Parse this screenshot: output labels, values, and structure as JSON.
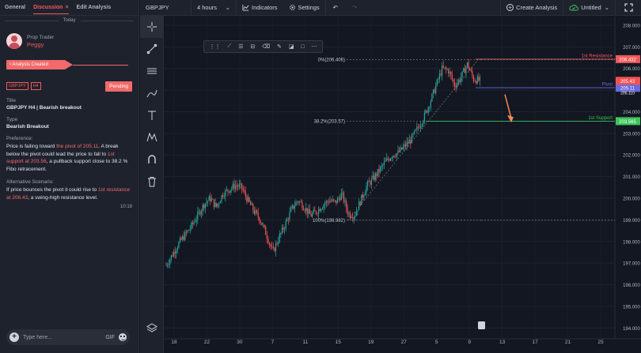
{
  "tabs": [
    {
      "label": "General"
    },
    {
      "label": "Discussion",
      "close": "×"
    },
    {
      "label": "Edit Analysis"
    }
  ],
  "day_separator": "Today",
  "trader": {
    "role": "Prop Trader",
    "name": "Peggy"
  },
  "status_banner": "♀Analysis Created",
  "tags": [
    "GBPJPY",
    "H4"
  ],
  "status_badge": "Pending",
  "labels": {
    "title": "Title",
    "type": "Type",
    "preference": "Preference:",
    "alternative": "Alternative Scenario:"
  },
  "analysis": {
    "title": "GBPJPY H4 | Bearish breakout",
    "type": "Bearish Breakout",
    "preference": {
      "t1": "Price is failing toward ",
      "h1": "the pivot of 205.11",
      "t2": ". A break below the pivot could lead the price to fall to ",
      "h2": "1st support at 203.56",
      "t3": ", a pullback support close to 38.2 % Fibo retracement."
    },
    "alternative": {
      "t1": "If price bounces the pivot it could rise to ",
      "h1": "1st resistance at 206.43",
      "t2": ", a swing-high resistance level."
    },
    "time": "10:18"
  },
  "comment": {
    "placeholder": "Type here...",
    "gif": "GIF"
  },
  "topbar": {
    "symbol": "GBPJPY",
    "interval": "4 hours",
    "indicators": "Indicators",
    "settings": "Settings",
    "create": "Create Analysis",
    "untitled": "Untitled"
  },
  "toolbar_icons": [
    "crosshair-icon",
    "trend-line-icon",
    "parallel-channel-icon",
    "brush-icon",
    "text-icon",
    "pattern-icon",
    "magnet-icon",
    "trash-icon",
    "layers-icon"
  ],
  "drawbar_icons": [
    "drag-handle-icon",
    "ray-icon",
    "horizontal-lines-icon",
    "channel-icon",
    "eraser-icon",
    "pen-icon",
    "fill-icon",
    "rectangle-icon",
    "more-icon"
  ],
  "colors": {
    "bull": "#26a69a",
    "bear": "#ef5350",
    "resistance": "#f05a5a",
    "pivot": "#6a6ae0",
    "support": "#3ec45a",
    "arrow": "#f7865a"
  },
  "chart_data": {
    "type": "candlestick",
    "symbol": "GBPJPY",
    "interval": "4 hours",
    "y_ticks": [
      "208.000",
      "207.000",
      "206.000",
      "205.000",
      "204.000",
      "203.000",
      "202.000",
      "201.000",
      "200.000",
      "199.000",
      "198.000",
      "197.000",
      "196.000",
      "195.000",
      "194.000"
    ],
    "x_ticks": [
      "18",
      "22",
      "30",
      "7",
      "11",
      "15",
      "19",
      "27",
      "5",
      "9",
      "13",
      "17",
      "21",
      "25"
    ],
    "ylim": [
      193.5,
      208.4
    ],
    "price_lines": [
      {
        "name": "1st Resistance",
        "value": 206.432,
        "label": "206.432",
        "color": "#f05a5a"
      },
      {
        "name": "Pivot",
        "value": 205.11,
        "label": "205.11",
        "color": "#6a6ae0"
      },
      {
        "name": "1st Support",
        "value": 203.565,
        "label": "203.565",
        "color": "#3ec45a"
      }
    ],
    "last_price": {
      "label": "205.43",
      "value": 205.43
    },
    "pivot_timer": "205.110",
    "fibonacci": [
      {
        "label": "0%(206.406)",
        "value": 206.406
      },
      {
        "label": "38.2%(203.57)",
        "value": 203.57
      },
      {
        "label": "100%(198.982)",
        "value": 198.982
      }
    ],
    "price_path": [
      196.9,
      197.4,
      197.9,
      198.3,
      198.7,
      199.2,
      199.7,
      200.0,
      199.6,
      200.2,
      200.4,
      200.6,
      200.5,
      199.9,
      199.4,
      199.0,
      198.3,
      197.5,
      198.2,
      198.8,
      199.5,
      199.9,
      199.6,
      199.2,
      199.4,
      199.7,
      199.9,
      199.8,
      200.2,
      199.3,
      199.2,
      199.9,
      200.6,
      200.9,
      201.3,
      201.7,
      202.0,
      202.1,
      202.4,
      202.7,
      203.2,
      203.7,
      204.4,
      205.2,
      206.0,
      205.9,
      205.2,
      205.6,
      206.2,
      205.5,
      205.43
    ]
  }
}
